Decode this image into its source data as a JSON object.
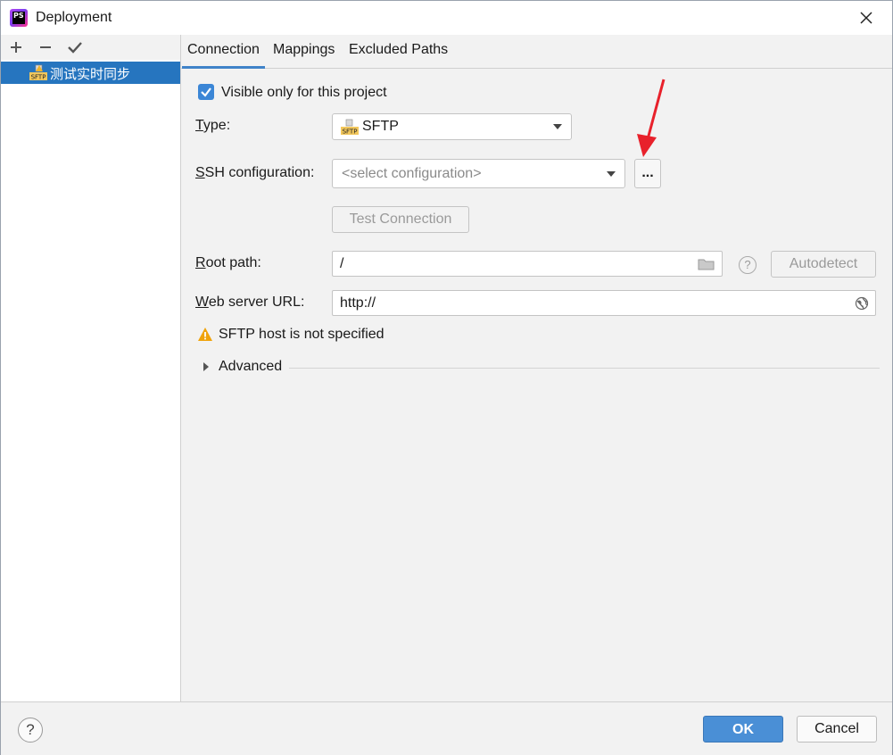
{
  "window": {
    "title": "Deployment"
  },
  "app_icon": {
    "text": "PS"
  },
  "sidebar": {
    "toolbar": {
      "add": "+",
      "remove": "−",
      "apply": "✔"
    },
    "items": [
      {
        "label": "测试实时同步",
        "icon": "sftp-server-icon",
        "selected": true
      }
    ]
  },
  "tabs": [
    {
      "label": "Connection",
      "active": true
    },
    {
      "label": "Mappings"
    },
    {
      "label": "Excluded Paths"
    }
  ],
  "connection": {
    "visible_only": {
      "label": "Visible only for this project",
      "checked": true
    },
    "type": {
      "label_prefix": "",
      "label_u": "T",
      "label_rest": "ype:",
      "value": "SFTP"
    },
    "ssh": {
      "label_u": "S",
      "label_rest": "SH configuration:",
      "placeholder": "<select configuration>",
      "browse": "..."
    },
    "test_connection": "Test Connection",
    "root_path": {
      "label_u": "R",
      "label_rest": "oot path:",
      "value": "/",
      "help": "?",
      "autodetect": "Autodetect"
    },
    "web_url": {
      "label_u": "W",
      "label_rest": "eb server URL:",
      "value": "http://"
    },
    "warning": "SFTP host is not specified",
    "advanced": "Advanced"
  },
  "footer": {
    "help": "?",
    "ok": "OK",
    "cancel": "Cancel"
  },
  "colors": {
    "accent": "#2675bf",
    "ok_button": "#4a8fd6",
    "annotation_arrow": "#e8212b",
    "warning": "#f0a30a"
  }
}
